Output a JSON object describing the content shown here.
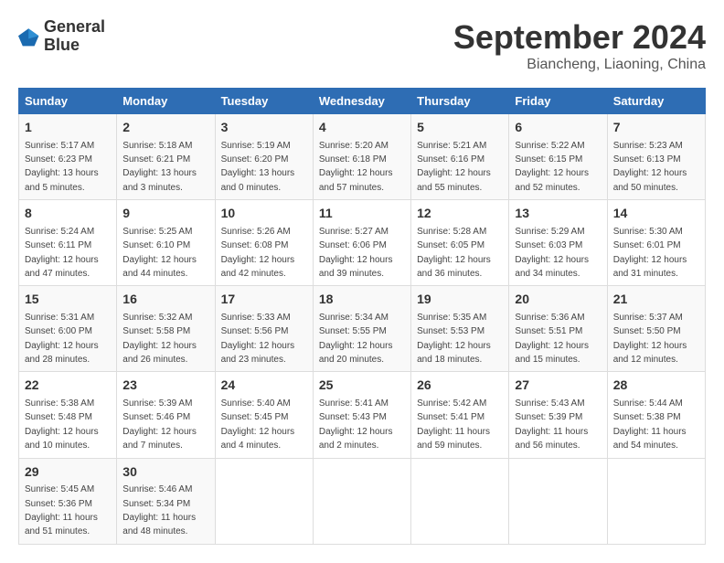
{
  "header": {
    "logo_line1": "General",
    "logo_line2": "Blue",
    "month_title": "September 2024",
    "location": "Biancheng, Liaoning, China"
  },
  "weekdays": [
    "Sunday",
    "Monday",
    "Tuesday",
    "Wednesday",
    "Thursday",
    "Friday",
    "Saturday"
  ],
  "weeks": [
    [
      {
        "day": "1",
        "sunrise": "5:17 AM",
        "sunset": "6:23 PM",
        "daylight": "13 hours and 5 minutes."
      },
      {
        "day": "2",
        "sunrise": "5:18 AM",
        "sunset": "6:21 PM",
        "daylight": "13 hours and 3 minutes."
      },
      {
        "day": "3",
        "sunrise": "5:19 AM",
        "sunset": "6:20 PM",
        "daylight": "13 hours and 0 minutes."
      },
      {
        "day": "4",
        "sunrise": "5:20 AM",
        "sunset": "6:18 PM",
        "daylight": "12 hours and 57 minutes."
      },
      {
        "day": "5",
        "sunrise": "5:21 AM",
        "sunset": "6:16 PM",
        "daylight": "12 hours and 55 minutes."
      },
      {
        "day": "6",
        "sunrise": "5:22 AM",
        "sunset": "6:15 PM",
        "daylight": "12 hours and 52 minutes."
      },
      {
        "day": "7",
        "sunrise": "5:23 AM",
        "sunset": "6:13 PM",
        "daylight": "12 hours and 50 minutes."
      }
    ],
    [
      {
        "day": "8",
        "sunrise": "5:24 AM",
        "sunset": "6:11 PM",
        "daylight": "12 hours and 47 minutes."
      },
      {
        "day": "9",
        "sunrise": "5:25 AM",
        "sunset": "6:10 PM",
        "daylight": "12 hours and 44 minutes."
      },
      {
        "day": "10",
        "sunrise": "5:26 AM",
        "sunset": "6:08 PM",
        "daylight": "12 hours and 42 minutes."
      },
      {
        "day": "11",
        "sunrise": "5:27 AM",
        "sunset": "6:06 PM",
        "daylight": "12 hours and 39 minutes."
      },
      {
        "day": "12",
        "sunrise": "5:28 AM",
        "sunset": "6:05 PM",
        "daylight": "12 hours and 36 minutes."
      },
      {
        "day": "13",
        "sunrise": "5:29 AM",
        "sunset": "6:03 PM",
        "daylight": "12 hours and 34 minutes."
      },
      {
        "day": "14",
        "sunrise": "5:30 AM",
        "sunset": "6:01 PM",
        "daylight": "12 hours and 31 minutes."
      }
    ],
    [
      {
        "day": "15",
        "sunrise": "5:31 AM",
        "sunset": "6:00 PM",
        "daylight": "12 hours and 28 minutes."
      },
      {
        "day": "16",
        "sunrise": "5:32 AM",
        "sunset": "5:58 PM",
        "daylight": "12 hours and 26 minutes."
      },
      {
        "day": "17",
        "sunrise": "5:33 AM",
        "sunset": "5:56 PM",
        "daylight": "12 hours and 23 minutes."
      },
      {
        "day": "18",
        "sunrise": "5:34 AM",
        "sunset": "5:55 PM",
        "daylight": "12 hours and 20 minutes."
      },
      {
        "day": "19",
        "sunrise": "5:35 AM",
        "sunset": "5:53 PM",
        "daylight": "12 hours and 18 minutes."
      },
      {
        "day": "20",
        "sunrise": "5:36 AM",
        "sunset": "5:51 PM",
        "daylight": "12 hours and 15 minutes."
      },
      {
        "day": "21",
        "sunrise": "5:37 AM",
        "sunset": "5:50 PM",
        "daylight": "12 hours and 12 minutes."
      }
    ],
    [
      {
        "day": "22",
        "sunrise": "5:38 AM",
        "sunset": "5:48 PM",
        "daylight": "12 hours and 10 minutes."
      },
      {
        "day": "23",
        "sunrise": "5:39 AM",
        "sunset": "5:46 PM",
        "daylight": "12 hours and 7 minutes."
      },
      {
        "day": "24",
        "sunrise": "5:40 AM",
        "sunset": "5:45 PM",
        "daylight": "12 hours and 4 minutes."
      },
      {
        "day": "25",
        "sunrise": "5:41 AM",
        "sunset": "5:43 PM",
        "daylight": "12 hours and 2 minutes."
      },
      {
        "day": "26",
        "sunrise": "5:42 AM",
        "sunset": "5:41 PM",
        "daylight": "11 hours and 59 minutes."
      },
      {
        "day": "27",
        "sunrise": "5:43 AM",
        "sunset": "5:39 PM",
        "daylight": "11 hours and 56 minutes."
      },
      {
        "day": "28",
        "sunrise": "5:44 AM",
        "sunset": "5:38 PM",
        "daylight": "11 hours and 54 minutes."
      }
    ],
    [
      {
        "day": "29",
        "sunrise": "5:45 AM",
        "sunset": "5:36 PM",
        "daylight": "11 hours and 51 minutes."
      },
      {
        "day": "30",
        "sunrise": "5:46 AM",
        "sunset": "5:34 PM",
        "daylight": "11 hours and 48 minutes."
      },
      null,
      null,
      null,
      null,
      null
    ]
  ]
}
